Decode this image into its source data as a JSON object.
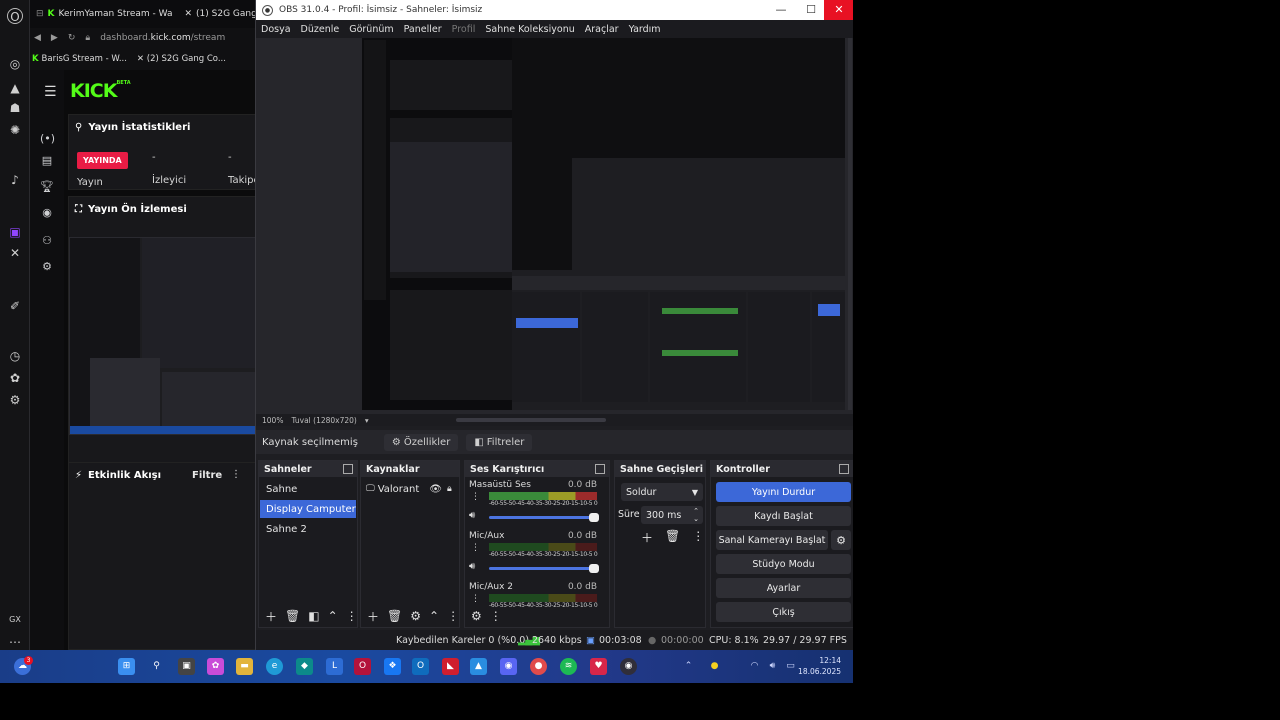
{
  "obs": {
    "title": "OBS 31.0.4 - Profil: İsimsiz - Sahneler: İsimsiz",
    "menu": [
      "Dosya",
      "Düzenle",
      "Görünüm",
      "Paneller",
      "Profil",
      "Sahne Koleksiyonu",
      "Araçlar",
      "Yardım"
    ],
    "zoom": "100%",
    "canvas": "Tuval (1280x720)",
    "source_toolbar": {
      "label": "Kaynak seçilmemiş",
      "properties": "Özellikler",
      "filters": "Filtreler"
    },
    "scenes": {
      "title": "Sahneler",
      "items": [
        "Sahne",
        "Display Camputer",
        "Sahne 2"
      ],
      "selected": 1
    },
    "sources": {
      "title": "Kaynaklar",
      "items": [
        "Valorant"
      ]
    },
    "mixer": {
      "title": "Ses Karıştırıcı",
      "scale": "-60-55-50-45-40-35-30-25-20-15-10-5 0",
      "channels": [
        {
          "name": "Masaüstü Ses",
          "db": "0.0 dB"
        },
        {
          "name": "Mic/Aux",
          "db": "0.0 dB"
        },
        {
          "name": "Mic/Aux 2",
          "db": "0.0 dB"
        }
      ]
    },
    "transitions": {
      "title": "Sahne Geçişleri",
      "type": "Soldur",
      "duration_label": "Süre",
      "duration": "300 ms"
    },
    "controls": {
      "title": "Kontroller",
      "buttons": [
        "Yayını Durdur",
        "Kaydı Başlat",
        "Sanal Kamerayı Başlat",
        "Stüdyo Modu",
        "Ayarlar",
        "Çıkış"
      ]
    },
    "status": {
      "dropped": "Kaybedilen Kareler 0 (%0.0)",
      "bitrate": "2640 kbps",
      "stream_time": "00:03:08",
      "rec_time": "00:00:00",
      "cpu": "CPU: 8.1%",
      "fps": "29.97 / 29.97 FPS"
    }
  },
  "browser": {
    "tabs": [
      "KerimYaman Stream - Wa",
      "(1) S2G Gang"
    ],
    "url_host": "dashboard.",
    "url_bold": "kick.com",
    "url_path": "/stream",
    "bookmarks": [
      "BarisG Stream - W...",
      "(2) S2G Gang Co..."
    ]
  },
  "kick": {
    "logo": "KICK",
    "logo_sup": "BETA",
    "stats_title": "Yayın İstatistikleri",
    "live_badge": "YAYINDA",
    "stat_labels": [
      "Yayın",
      "İzleyici",
      "Takipç"
    ],
    "stat_values": [
      "-",
      "-"
    ],
    "preview_title": "Yayın Ön İzlemesi",
    "activity_title": "Etkinlik Akışı",
    "activity_filter": "Filtre"
  },
  "gx_label": "GX",
  "clock": {
    "time": "12:14",
    "date": "18.06.2025"
  },
  "taskbar_badge": "3",
  "colors": {
    "accent": "#3c68d8",
    "kick_green": "#53fc18",
    "live_red": "#e91c45",
    "close_red": "#e81123"
  }
}
